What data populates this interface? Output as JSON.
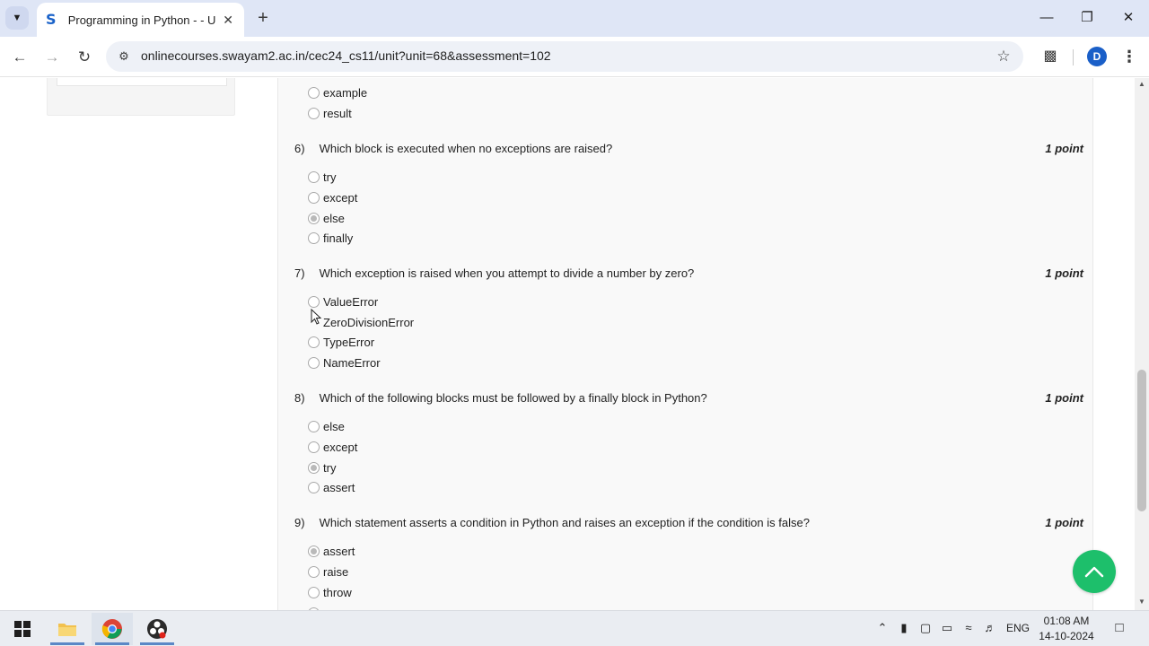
{
  "browser": {
    "tab_title": "Programming in Python - - Unit",
    "url": "onlinecourses.swayam2.ac.in/cec24_cs11/unit?unit=68&assessment=102",
    "profile_initial": "D"
  },
  "quiz": {
    "prev_options": [
      {
        "label": "example",
        "selected": false
      },
      {
        "label": "result",
        "selected": false
      }
    ],
    "questions": [
      {
        "number": "6)",
        "text": "Which block is executed when no exceptions are raised?",
        "points": "1 point",
        "options": [
          {
            "label": " try",
            "selected": false
          },
          {
            "label": "except",
            "selected": false
          },
          {
            "label": "else",
            "selected": true
          },
          {
            "label": "finally",
            "selected": false
          }
        ]
      },
      {
        "number": "7)",
        "text": "Which exception is raised when you attempt to divide a number by zero?",
        "points": "1 point",
        "options": [
          {
            "label": "ValueError",
            "selected": false
          },
          {
            "label": "ZeroDivisionError",
            "selected": false
          },
          {
            "label": "TypeError",
            "selected": false
          },
          {
            "label": "NameError",
            "selected": false
          }
        ]
      },
      {
        "number": "8)",
        "text": "Which of the following blocks must be followed by a finally block in Python?",
        "points": "1 point",
        "options": [
          {
            "label": "else",
            "selected": false
          },
          {
            "label": "except",
            "selected": false
          },
          {
            "label": "try",
            "selected": true
          },
          {
            "label": "assert",
            "selected": false
          }
        ]
      },
      {
        "number": "9)",
        "text": "Which statement asserts a condition in Python and raises an exception if the condition is false?",
        "points": "1 point",
        "options": [
          {
            "label": "assert",
            "selected": true
          },
          {
            "label": "raise",
            "selected": false
          },
          {
            "label": "throw",
            "selected": false
          }
        ]
      }
    ]
  },
  "taskbar": {
    "language": "ENG",
    "time": "01:08 AM",
    "date": "14-10-2024"
  },
  "colors": {
    "accent_green": "#1dbf6b",
    "tabbar_bg": "#dfe6f6",
    "profile_blue": "#1a5fc8"
  }
}
